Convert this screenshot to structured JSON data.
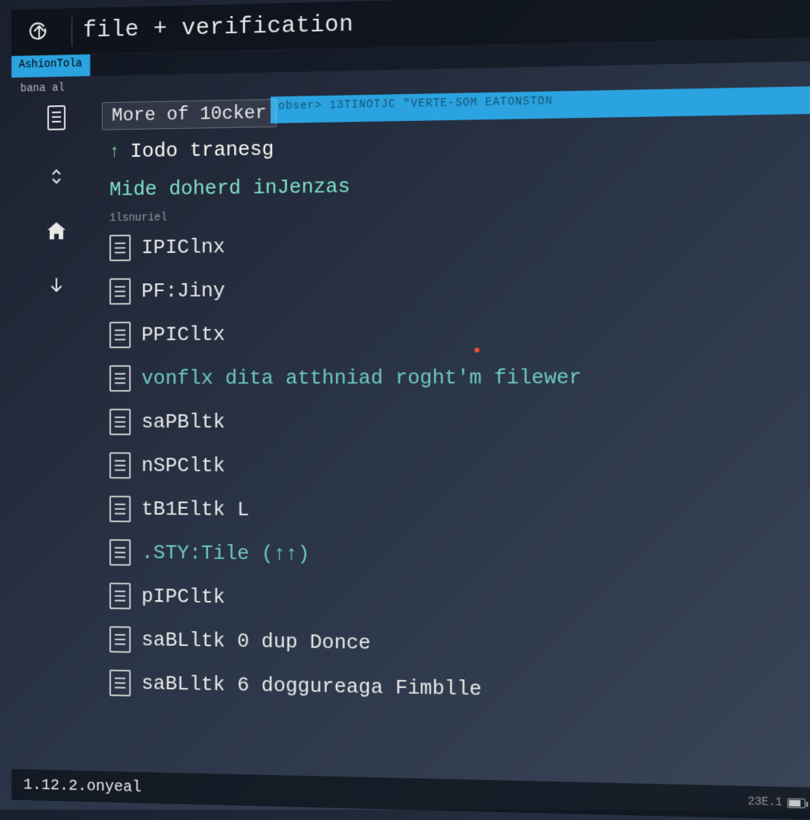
{
  "titlebar": {
    "title": "file + verification"
  },
  "tabs": [
    {
      "label": "AshionTola",
      "active": true
    },
    {
      "label": "",
      "active": false
    }
  ],
  "subrow": {
    "left_label": "bana al"
  },
  "blue_bar_text": "obser> 13TINOTJC  \"VERTE-SOM EATONSTON",
  "header_chip": "More of 10cker",
  "todo_line": {
    "arrow": "↑",
    "text": "Iodo tranesg"
  },
  "green_header": {
    "text": "Mide doherd inJenzas",
    "sub": "1lsnuriel"
  },
  "files": [
    {
      "label": "IPIClnx",
      "cls": "white"
    },
    {
      "label": "PF:Jiny",
      "cls": "white"
    },
    {
      "label": "PPICltx",
      "cls": "white"
    },
    {
      "label": "vonflx dita atthniad roght'm filewer",
      "cls": "teal"
    },
    {
      "label": "saPBltk",
      "cls": "white"
    },
    {
      "label": "nSPCltk",
      "cls": "white"
    },
    {
      "label": "tB1Eltk L",
      "cls": "white"
    },
    {
      "label": ".STY:Tile (↑↑)",
      "cls": "teal"
    },
    {
      "label": "pIPCltk",
      "cls": "white"
    },
    {
      "label": "saBLltk 0 dup Donce",
      "cls": "white"
    },
    {
      "label": "saBLltk 6 doggureaga Fimblle",
      "cls": "white"
    }
  ],
  "statusbar": {
    "left": "1.12.2.onyeal",
    "right": "23E.1"
  }
}
